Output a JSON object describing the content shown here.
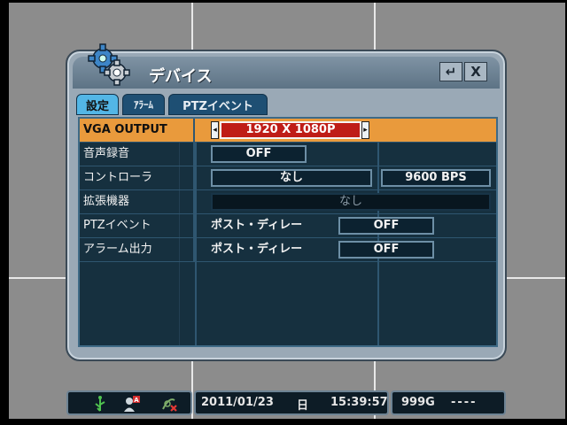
{
  "dialog": {
    "title": "デバイス",
    "buttons": {
      "back": "↵",
      "close": "X"
    },
    "tabs": [
      {
        "label": "設定",
        "active": true
      },
      {
        "label": "ｱﾗｰﾑ",
        "active": false
      },
      {
        "label": "PTZイベント",
        "active": false
      }
    ]
  },
  "rows": {
    "vga": {
      "label": "VGA OUTPUT",
      "value": "1920 X 1080P"
    },
    "audio": {
      "label": "音声録音",
      "value": "OFF"
    },
    "controller": {
      "label": "コントローラ",
      "value": "なし",
      "baud": "9600 BPS"
    },
    "expansion": {
      "label": "拡張機器",
      "value": "なし"
    },
    "ptz_event": {
      "label": "PTZイベント",
      "sub": "ポスト・ディレー",
      "value": "OFF"
    },
    "alarm_out": {
      "label": "アラーム出力",
      "sub": "ポスト・ディレー",
      "value": "OFF"
    }
  },
  "statusbar": {
    "icons": [
      "usb-icon",
      "user-alert-icon",
      "network-off-icon"
    ],
    "date": "2011/01/23",
    "weekday": "日",
    "time": "15:39:57",
    "storage": "999G",
    "storage_status": "----"
  },
  "colors": {
    "selected_row": "#e99a3c",
    "selected_value": "#bf1d17",
    "tab_active": "#53b6e6"
  }
}
